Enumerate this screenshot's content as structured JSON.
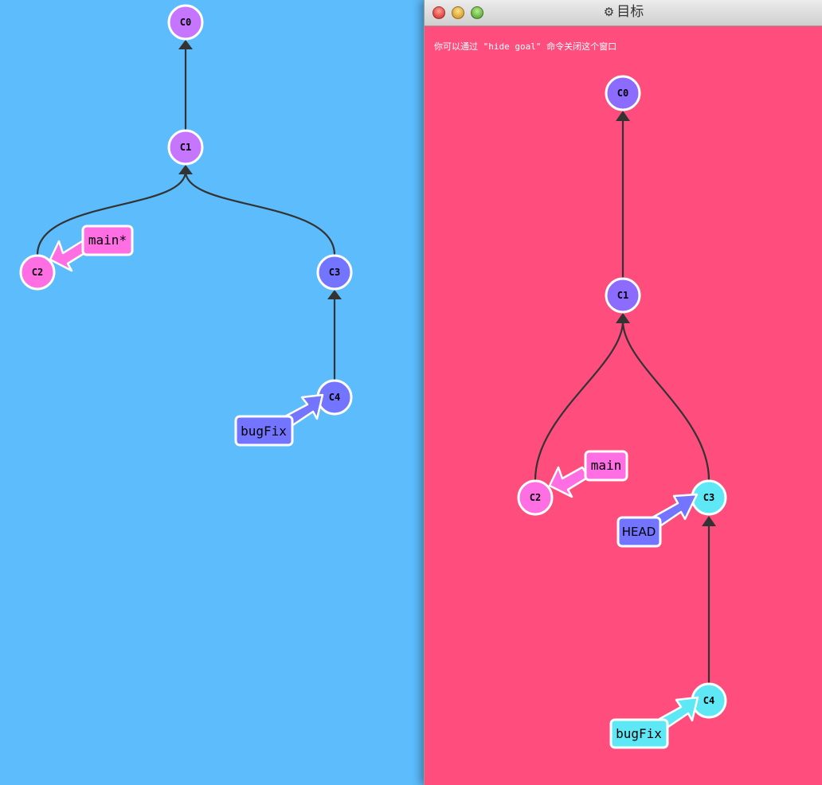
{
  "main_view": {
    "commits": [
      {
        "id": "C0",
        "color": "#c575ff"
      },
      {
        "id": "C1",
        "color": "#c575ff"
      },
      {
        "id": "C2",
        "color": "#ff6ee3"
      },
      {
        "id": "C3",
        "color": "#7374ff"
      },
      {
        "id": "C4",
        "color": "#7374ff"
      }
    ],
    "branches": [
      {
        "name": "main*",
        "color": "#ff6ee3"
      },
      {
        "name": "bugFix",
        "color": "#7374ff"
      }
    ]
  },
  "goal_window": {
    "title": "目标",
    "title_icon": "gear-icon",
    "hint": "你可以通过 \"hide goal\" 命令关闭这个窗口",
    "commits": [
      {
        "id": "C0",
        "color": "#8c6bff"
      },
      {
        "id": "C1",
        "color": "#8c6bff"
      },
      {
        "id": "C2",
        "color": "#ff6ee3"
      },
      {
        "id": "C3",
        "color": "#5ee8f5"
      },
      {
        "id": "C4",
        "color": "#5ee8f5"
      }
    ],
    "branches": [
      {
        "name": "main",
        "color": "#ff6ee3"
      },
      {
        "name": "bugFix",
        "color": "#5ee8f5"
      }
    ],
    "head": {
      "name": "HEAD",
      "color": "#7374ff"
    }
  }
}
